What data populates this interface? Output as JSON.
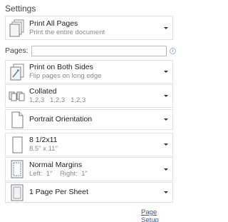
{
  "settings": {
    "title": "Settings"
  },
  "print_what": {
    "main": "Print All Pages",
    "sub": "Print the entire document",
    "icon": "print-all-pages-icon"
  },
  "pages": {
    "label": "Pages:",
    "value": "",
    "placeholder": "",
    "info_icon": "info-icon"
  },
  "sides": {
    "main": "Print on Both Sides",
    "sub": "Flip pages on long edge",
    "icon": "duplex-print-icon"
  },
  "collation": {
    "main": "Collated",
    "sub": "1,2,3   1,2,3   1,2,3",
    "icon": "collated-icon"
  },
  "orientation": {
    "main": "Portrait Orientation",
    "icon": "portrait-icon"
  },
  "paper_size": {
    "main": "8 1/2x11",
    "sub": "8.5\" x 11\"",
    "icon": "paper-size-icon"
  },
  "margins": {
    "main": "Normal Margins",
    "sub": "Left:  1\"    Right:  1\"",
    "icon": "margins-icon"
  },
  "pages_per_sheet": {
    "main": "1 Page Per Sheet",
    "icon": "pages-per-sheet-icon"
  },
  "footer": {
    "page_setup_label": "Page Setup"
  }
}
